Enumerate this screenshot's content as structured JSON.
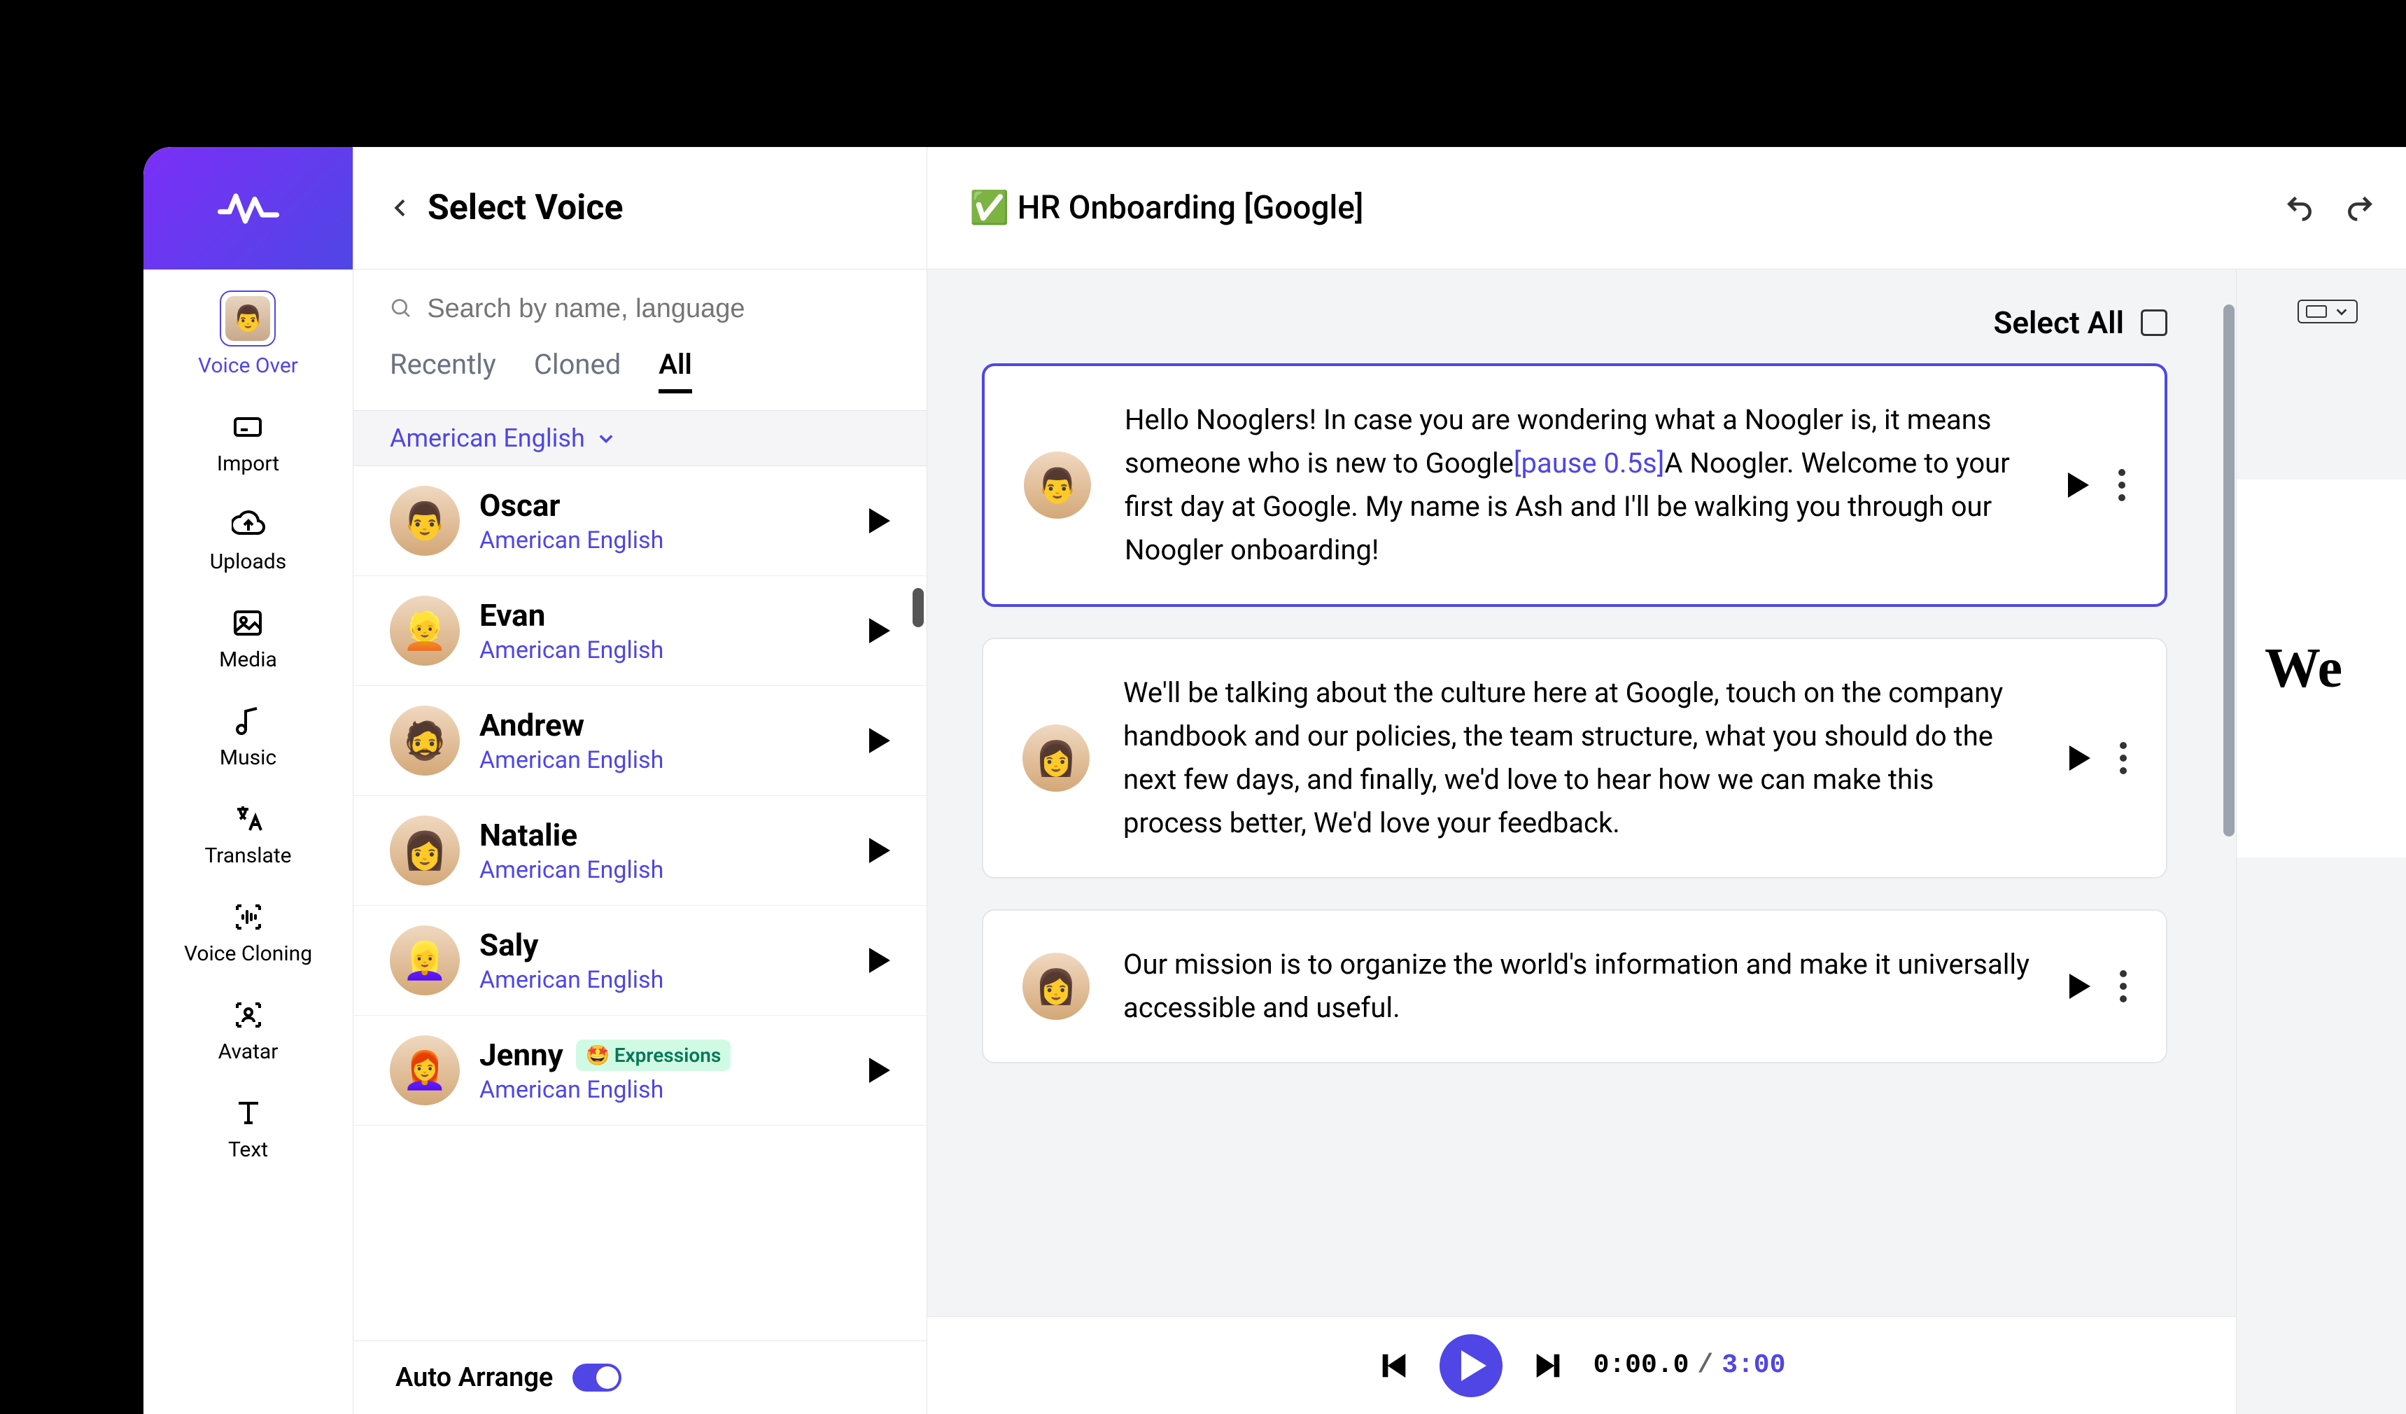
{
  "sidebar": {
    "items": [
      {
        "label": "Voice Over"
      },
      {
        "label": "Import"
      },
      {
        "label": "Uploads"
      },
      {
        "label": "Media"
      },
      {
        "label": "Music"
      },
      {
        "label": "Translate"
      },
      {
        "label": "Voice Cloning"
      },
      {
        "label": "Avatar"
      },
      {
        "label": "Text"
      }
    ]
  },
  "voice_panel": {
    "title": "Select Voice",
    "search_placeholder": "Search by name, language",
    "tabs": [
      {
        "label": "Recently"
      },
      {
        "label": "Cloned"
      },
      {
        "label": "All"
      }
    ],
    "active_tab": 2,
    "language_dropdown": "American English",
    "voices": [
      {
        "name": "Oscar",
        "language": "American English"
      },
      {
        "name": "Evan",
        "language": "American English"
      },
      {
        "name": "Andrew",
        "language": "American English"
      },
      {
        "name": "Natalie",
        "language": "American English"
      },
      {
        "name": "Saly",
        "language": "American English"
      },
      {
        "name": "Jenny",
        "language": "American English",
        "badge_icon": "🤩",
        "badge": "Expressions"
      }
    ],
    "auto_arrange_label": "Auto Arrange",
    "auto_arrange_on": true
  },
  "main": {
    "project_title": "✅ HR Onboarding [Google]",
    "select_all_label": "Select All",
    "blocks": [
      {
        "text_pre": "Hello Nooglers! In case you are wondering what a Noogler is, it  means someone who is new to Google",
        "pause": "[pause 0.5s]",
        "text_post": "A Noogler. Welcome to your first day at Google. My name is Ash and I'll be walking you through our Noogler onboarding!",
        "selected": true
      },
      {
        "text_pre": "We'll be talking about the culture here at Google, touch on the company handbook and our policies, the team structure, what you should do the next few days, and finally, we'd love to hear how we can make this process better, We'd love your feedback.",
        "pause": "",
        "text_post": "",
        "selected": false
      },
      {
        "text_pre": "Our mission is to organize the world's information and make it universally accessible and useful.",
        "pause": "",
        "text_post": "",
        "selected": false
      }
    ],
    "preview_text": "We"
  },
  "player": {
    "current_time": "0:00.0",
    "separator": "/",
    "total_time": "3:00"
  }
}
